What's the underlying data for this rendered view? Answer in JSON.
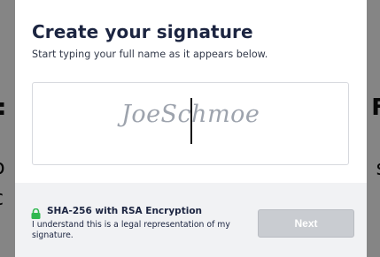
{
  "background_page": {
    "left_fragments": [
      ":",
      "o",
      "c"
    ],
    "right_fragments": [
      "F",
      "s",
      "l"
    ]
  },
  "modal": {
    "title": "Create your signature",
    "subtitle": "Start typing your full name as it appears below.",
    "signature_input": {
      "value": "JoeSchmoe"
    },
    "footer": {
      "encryption_icon": "lock-icon",
      "encryption_title": "SHA-256 with RSA Encryption",
      "encryption_description": "I understand this is a legal representation of my signature.",
      "next_label": "Next",
      "next_enabled": false
    }
  },
  "colors": {
    "title": "#1c2541",
    "lock": "#2fb84f",
    "button_disabled_bg": "#c9ccd1",
    "signature_ink": "#9da3ad"
  }
}
